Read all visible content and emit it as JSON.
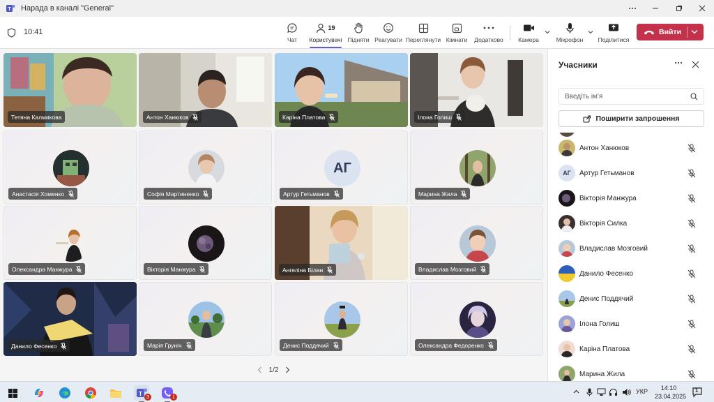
{
  "window": {
    "title": "Нарада в каналі \"General\""
  },
  "meeting": {
    "time": "10:41"
  },
  "toolbar": {
    "chat": "Чат",
    "people": "Користувачі",
    "people_count": "19",
    "raise": "Підняти",
    "react": "Реагувати",
    "view": "Переглянути",
    "rooms": "Кімнати",
    "more": "Додатково",
    "camera": "Камера",
    "mic": "Мікрофон",
    "share": "Поділитися",
    "leave": "Вийти"
  },
  "tiles": [
    {
      "name": "Тетяна Калмикова",
      "muted": false
    },
    {
      "name": "Антон Ханюков",
      "muted": true
    },
    {
      "name": "Каріна Платова",
      "muted": true
    },
    {
      "name": "Ілона Голиш",
      "muted": true
    },
    {
      "name": "Анастасія Хоменко",
      "muted": true
    },
    {
      "name": "Софія Мартиненко",
      "muted": true
    },
    {
      "name": "Артур Гетьманов",
      "muted": true,
      "initials": "АГ"
    },
    {
      "name": "Марина Жила",
      "muted": true
    },
    {
      "name": "Олександра Манжура",
      "muted": true
    },
    {
      "name": "Вікторія Манжура",
      "muted": true
    },
    {
      "name": "Ангеліна Білан",
      "muted": true
    },
    {
      "name": "Владислав Мозговий",
      "muted": true
    },
    {
      "name": "Данило Фесенко",
      "muted": true
    },
    {
      "name": "Марія Груніч",
      "muted": true
    },
    {
      "name": "Денис Поддячий",
      "muted": true
    },
    {
      "name": "Олександра Федоренко",
      "muted": true
    }
  ],
  "pager": {
    "label": "1/2"
  },
  "panel": {
    "title": "Учасники",
    "search_placeholder": "Введіть ім'я",
    "share_invite": "Поширити запрошення",
    "participants": [
      {
        "name": "Антон Ханюков"
      },
      {
        "name": "Артур Гетьманов",
        "initials": "АГ"
      },
      {
        "name": "Вікторія Манжура"
      },
      {
        "name": "Вікторія Силка"
      },
      {
        "name": "Владислав Мозговий"
      },
      {
        "name": "Данило Фесенко"
      },
      {
        "name": "Денис Поддячий"
      },
      {
        "name": "Ілона Голиш"
      },
      {
        "name": "Каріна Платова"
      },
      {
        "name": "Марина Жила"
      }
    ]
  },
  "taskbar": {
    "teams_badge": "3",
    "viber_badge": "1",
    "lang": "УКР",
    "clock_time": "14:10",
    "clock_date": "23.04.2025",
    "notif_count": "1"
  }
}
